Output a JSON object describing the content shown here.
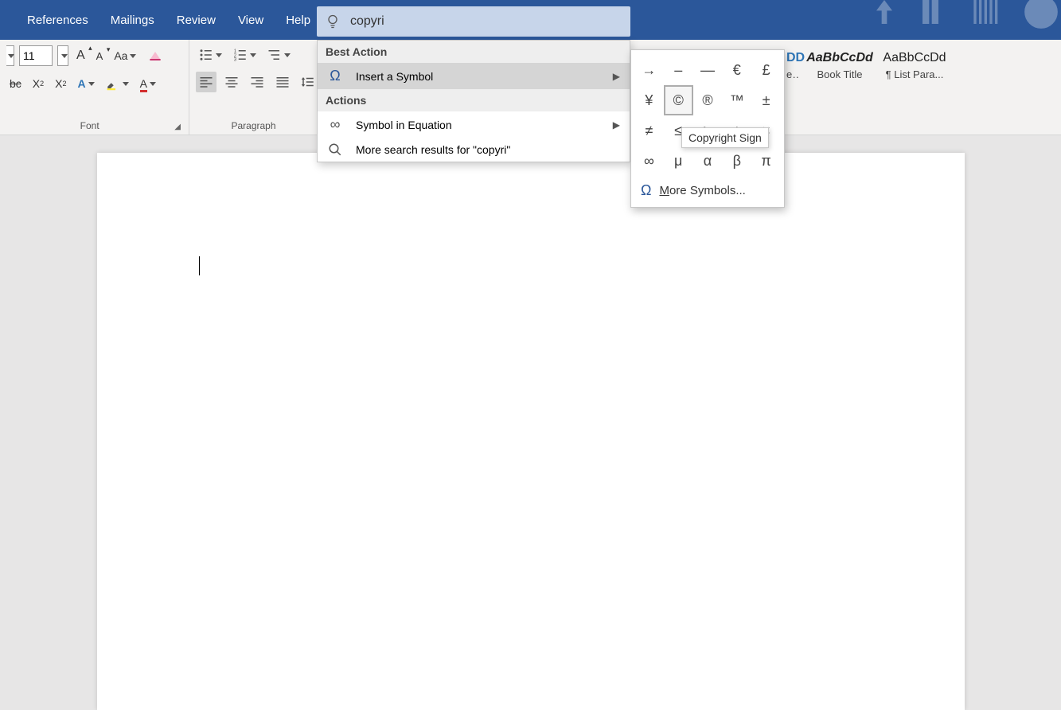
{
  "titlebar": {
    "tabs": [
      "References",
      "Mailings",
      "Review",
      "View",
      "Help"
    ]
  },
  "search": {
    "value": "copyri"
  },
  "ribbon": {
    "font": {
      "size": "11",
      "group_label": "Font"
    },
    "paragraph": {
      "group_label": "Paragraph"
    },
    "styles_visible": [
      {
        "sample": "AaBbCcDd",
        "name": "Book Title",
        "italic": true,
        "bold": true
      },
      {
        "sample": "AaBbCcDd",
        "name": "¶ List Para...",
        "italic": false,
        "bold": false
      }
    ],
    "style_trunc": {
      "sample": "DD",
      "name": "e..."
    }
  },
  "tellme": {
    "header_best": "Best Action",
    "item_insert_symbol": "Insert a Symbol",
    "header_actions": "Actions",
    "item_symbol_eq": "Symbol in Equation",
    "item_more_results": "More search results for \"copyri\""
  },
  "symbols": {
    "grid": [
      "→",
      "–",
      "—",
      "€",
      "£",
      "¥",
      "©",
      "®",
      "™",
      "±",
      "≠",
      "≤",
      "≥",
      "÷",
      "×",
      "∞",
      "μ",
      "α",
      "β",
      "π"
    ],
    "selected_index": 6,
    "more_label": "ore Symbols...",
    "more_prefix": "M",
    "tooltip": "Copyright Sign"
  }
}
